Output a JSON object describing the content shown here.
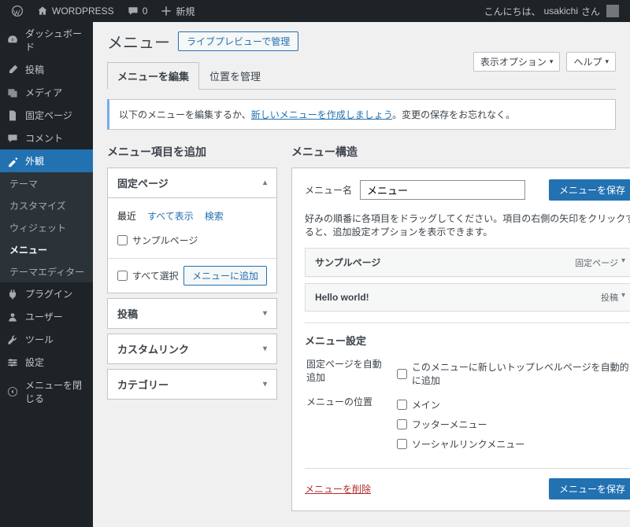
{
  "adminbar": {
    "site": "WORDPRESS",
    "comments": "0",
    "new": "新規",
    "greeting": "こんにちは、",
    "user": "usakichi",
    "suffix": " さん"
  },
  "screen": {
    "options": "表示オプション",
    "help": "ヘルプ"
  },
  "sidebar": {
    "dashboard": "ダッシュボード",
    "posts": "投稿",
    "media": "メディア",
    "pages": "固定ページ",
    "comments": "コメント",
    "appearance": "外観",
    "sub": {
      "themes": "テーマ",
      "customize": "カスタマイズ",
      "widgets": "ウィジェット",
      "menus": "メニュー",
      "editor": "テーマエディター"
    },
    "plugins": "プラグイン",
    "users": "ユーザー",
    "tools": "ツール",
    "settings": "設定",
    "collapse": "メニューを閉じる"
  },
  "page": {
    "title": "メニュー",
    "live_preview": "ライブプレビューで管理",
    "tab_edit": "メニューを編集",
    "tab_locations": "位置を管理",
    "notice_prefix": "以下のメニューを編集するか、",
    "notice_link": "新しいメニューを作成しましょう",
    "notice_suffix": "。変更の保存をお忘れなく。"
  },
  "add": {
    "heading": "メニュー項目を追加",
    "pages": "固定ページ",
    "posts": "投稿",
    "custom": "カスタムリンク",
    "categories": "カテゴリー",
    "subtabs": {
      "recent": "最近",
      "all": "すべて表示",
      "search": "検索"
    },
    "sample_page": "サンプルページ",
    "select_all": "すべて選択",
    "add_button": "メニューに追加"
  },
  "structure": {
    "heading": "メニュー構造",
    "name_label": "メニュー名",
    "name_value": "メニュー",
    "save": "メニューを保存",
    "help": "好みの順番に各項目をドラッグしてください。項目の右側の矢印をクリックすると、追加設定オプションを表示できます。",
    "items": [
      {
        "title": "サンプルページ",
        "type": "固定ページ"
      },
      {
        "title": "Hello world!",
        "type": "投稿"
      }
    ],
    "settings_heading": "メニュー設定",
    "auto_add_label": "固定ページを自動追加",
    "auto_add_checkbox": "このメニューに新しいトップレベルページを自動的に追加",
    "location_label": "メニューの位置",
    "locations": [
      "メイン",
      "フッターメニュー",
      "ソーシャルリンクメニュー"
    ],
    "delete": "メニューを削除"
  }
}
